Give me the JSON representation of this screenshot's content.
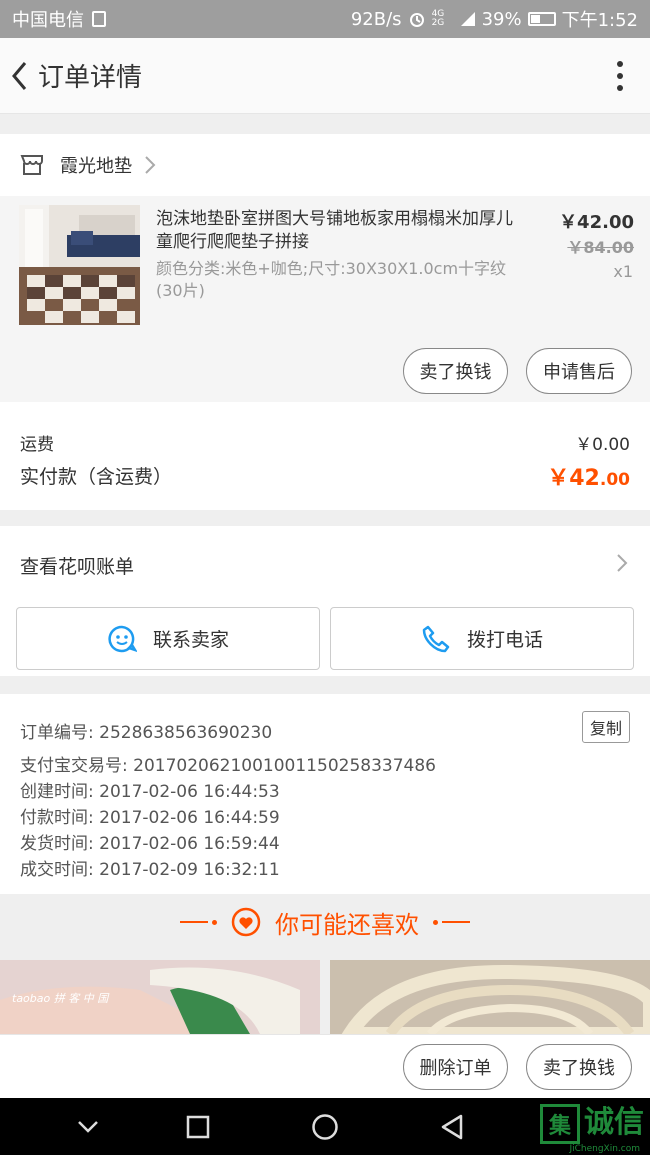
{
  "status": {
    "carrier": "中国电信",
    "speed": "92B/s",
    "network": "4G 2G",
    "battery": "39%",
    "battery_level": 0.39,
    "time": "下午1:52"
  },
  "nav": {
    "title": "订单详情"
  },
  "shop": {
    "name": "霞光地垫"
  },
  "item": {
    "title": "泡沫地垫卧室拼图大号铺地板家用榻榻米加厚儿童爬行爬爬垫子拼接",
    "spec": "颜色分类:米色+咖色;尺寸:30X30X1.0cm十字纹(30片)",
    "price": "￥42.00",
    "original_price": "￥84.00",
    "quantity": "x1",
    "btn_exchange": "卖了换钱",
    "btn_aftersale": "申请售后"
  },
  "fees": {
    "shipping_label": "运费",
    "shipping_value": "￥0.00",
    "paid_label": "实付款（含运费）",
    "paid_currency_int": "￥42",
    "paid_decimal": ".00"
  },
  "huabei": {
    "label": "查看花呗账单"
  },
  "contact": {
    "seller": "联系卖家",
    "call": "拨打电话"
  },
  "order_info": {
    "order_no": "订单编号: 2528638563690230",
    "copy": "复制",
    "alipay_no": "支付宝交易号: 2017020621001001150258337486",
    "created": "创建时间: 2017-02-06 16:44:53",
    "paid": "付款时间: 2017-02-06 16:44:59",
    "shipped": "发货时间: 2017-02-06 16:59:44",
    "completed": "成交时间: 2017-02-09 16:32:11"
  },
  "recommend": {
    "title": "你可能还喜欢",
    "product1_text": "taobao 拼 客 中 国"
  },
  "bottom": {
    "delete": "删除订单",
    "exchange": "卖了换钱"
  },
  "watermark": {
    "logo": "集",
    "text": "诚信",
    "url": "JiChengXin.com"
  },
  "colors": {
    "accent": "#ff5000",
    "statusbar": "#9e9e9e"
  }
}
